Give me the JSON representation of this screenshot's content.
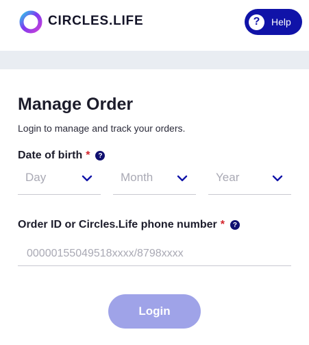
{
  "header": {
    "brand": "CIRCLES.LIFE",
    "help_label": "Help",
    "help_glyph": "?"
  },
  "main": {
    "title": "Manage Order",
    "subtitle": "Login to manage and track your orders.",
    "dob": {
      "label": "Date of birth",
      "required_mark": "*",
      "info_glyph": "?",
      "day_placeholder": "Day",
      "month_placeholder": "Month",
      "year_placeholder": "Year"
    },
    "order": {
      "label": "Order ID or Circles.Life phone number",
      "required_mark": "*",
      "info_glyph": "?",
      "placeholder": "00000155049518xxxx/8798xxxx",
      "value": ""
    },
    "login_label": "Login"
  },
  "colors": {
    "brand_blue": "#1013a8",
    "required_red": "#d3232b",
    "login_disabled": "#9fa3e8",
    "band_gray": "#e9edf2"
  },
  "icons": {
    "logo": "circles-ring-logo",
    "help": "question-circle-icon",
    "select": "chevron-down-icon"
  }
}
